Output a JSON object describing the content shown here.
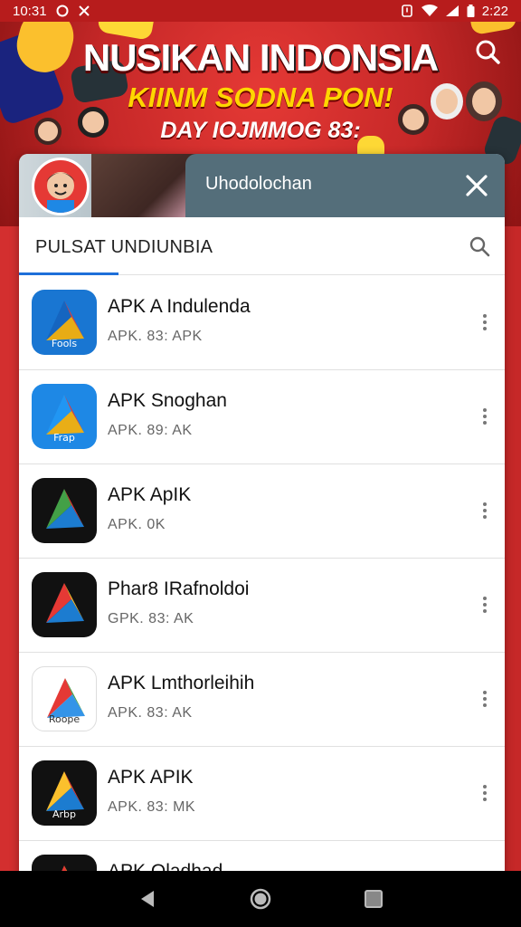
{
  "status": {
    "time": "10:31",
    "battery_time": "2:22"
  },
  "banner": {
    "title": "NUSIKAN INDONSIA",
    "subtitle": "KIINM SODNA PON!",
    "tagline": "DAY IOJMMOG 83:"
  },
  "sheet": {
    "header_title": "Uhodolochan",
    "search_label": "PULSAT UNDIUNBIA"
  },
  "apps": [
    {
      "title": "APK A Indulenda",
      "sub": "APK. 83: APK",
      "icon_text": "Fools",
      "colors": [
        "#1565c0",
        "#e53935",
        "#ffb300"
      ],
      "bg": "#1976d2"
    },
    {
      "title": "APK Snoghan",
      "sub": "APK. 89: AK",
      "icon_text": "Frap",
      "colors": [
        "#2196f3",
        "#e53935",
        "#ffb300"
      ],
      "bg": "#1e88e5"
    },
    {
      "title": "APK ApIK",
      "sub": "APK. 0K",
      "icon_text": "",
      "colors": [
        "#43a047",
        "#e53935",
        "#1e88e5"
      ],
      "bg": "#111111"
    },
    {
      "title": "Phar8 IRafnoldoi",
      "sub": "GPK. 83: AK",
      "icon_text": "",
      "colors": [
        "#e53935",
        "#fbc02d",
        "#1e88e5"
      ],
      "bg": "#111111"
    },
    {
      "title": "APK Lmthorleihih",
      "sub": "APK. 83: AK",
      "icon_text": "Roope",
      "colors": [
        "#e53935",
        "#43a047",
        "#1e88e5"
      ],
      "bg": "#ffffff"
    },
    {
      "title": "APK APIK",
      "sub": "APK. 83: MK",
      "icon_text": "Arbp",
      "colors": [
        "#fbc02d",
        "#e53935",
        "#1e88e5"
      ],
      "bg": "#111111"
    },
    {
      "title": "APK Oladhad",
      "sub": "",
      "icon_text": "",
      "colors": [
        "#e53935",
        "#fbc02d",
        "#1e88e5"
      ],
      "bg": "#111111"
    }
  ]
}
